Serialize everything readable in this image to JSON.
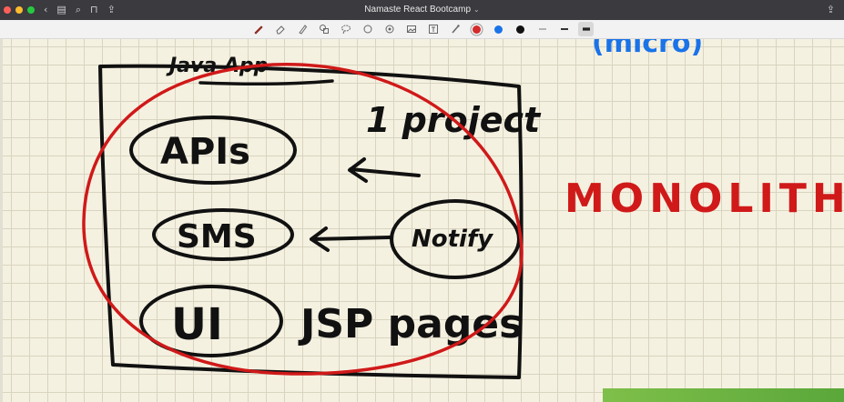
{
  "window": {
    "title": "Namaste React Bootcamp",
    "title_chevron": "⌄"
  },
  "titlebar": {
    "back_glyph": "‹",
    "sidebar_glyph": "▤",
    "search_glyph": "⌕",
    "bookmark_glyph": "⊓",
    "share_glyph": "⇪",
    "right_share_glyph": "⇪"
  },
  "toolbar": {
    "tools": [
      {
        "name": "pen-tool",
        "icon": "pen-icon"
      },
      {
        "name": "eraser-tool",
        "icon": "eraser-icon"
      },
      {
        "name": "highlighter-tool",
        "icon": "highlighter-icon"
      },
      {
        "name": "shape-tool",
        "icon": "shapes-icon"
      },
      {
        "name": "lasso-tool",
        "icon": "lasso-icon"
      },
      {
        "name": "lasso-select-tool",
        "icon": "lasso-select-icon"
      },
      {
        "name": "element-tool",
        "icon": "element-icon"
      },
      {
        "name": "image-tool",
        "icon": "image-icon"
      },
      {
        "name": "text-tool",
        "icon": "text-icon"
      },
      {
        "name": "laser-tool",
        "icon": "laser-icon"
      }
    ],
    "colors": [
      "#d42a2a",
      "#1a73e8",
      "#111111"
    ],
    "selected_color": "#d42a2a"
  },
  "canvas": {
    "background": "#f5f1e1",
    "grid_color": "#d8d4c0",
    "handwriting": {
      "java_app": "Java App",
      "apis": "APIs",
      "sms": "SMS",
      "ui": "UI",
      "jsp_pages": "JSP pages",
      "one_project": "1 project",
      "notification": "Notify",
      "monolith": "MONOLITH",
      "top_right_blue": "(micro)"
    },
    "ink_colors": {
      "black": "#111111",
      "red": "#d01919",
      "blue": "#1a73e8"
    }
  }
}
